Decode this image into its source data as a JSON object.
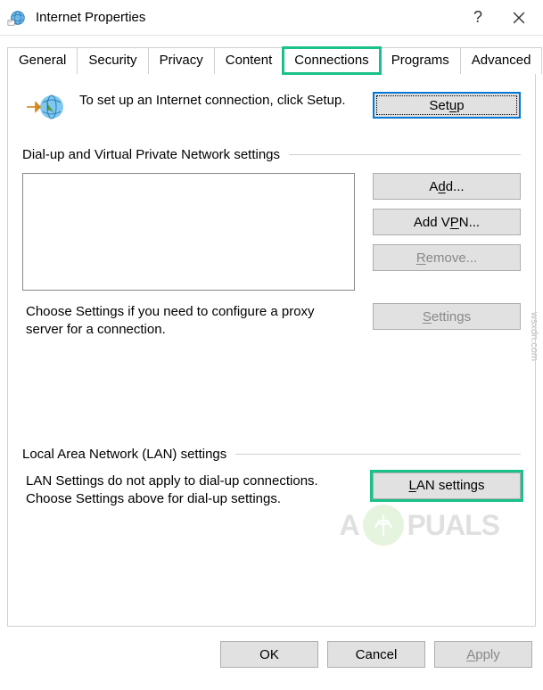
{
  "title": "Internet Properties",
  "tabs": {
    "general": "General",
    "security": "Security",
    "privacy": "Privacy",
    "content": "Content",
    "connections": "Connections",
    "programs": "Programs",
    "advanced": "Advanced"
  },
  "setup": {
    "text": "To set up an Internet connection, click Setup.",
    "button_pre": "Set",
    "button_u": "u",
    "button_post": "p"
  },
  "dialup": {
    "header": "Dial-up and Virtual Private Network settings",
    "add_pre": "A",
    "add_u": "d",
    "add_post": "d...",
    "addvpn_pre": "Add V",
    "addvpn_u": "P",
    "addvpn_post": "N...",
    "remove_u": "R",
    "remove_post": "emove...",
    "settings_u": "S",
    "settings_post": "ettings",
    "proxy_text": "Choose Settings if you need to configure a proxy server for a connection."
  },
  "lan": {
    "header": "Local Area Network (LAN) settings",
    "text": "LAN Settings do not apply to dial-up connections. Choose Settings above for dial-up settings.",
    "button_u": "L",
    "button_post": "AN settings"
  },
  "bottom": {
    "ok": "OK",
    "cancel": "Cancel",
    "apply_u": "A",
    "apply_post": "pply"
  },
  "watermark": {
    "left": "A",
    "right": "PUALS"
  },
  "source": "wsxdn.com"
}
